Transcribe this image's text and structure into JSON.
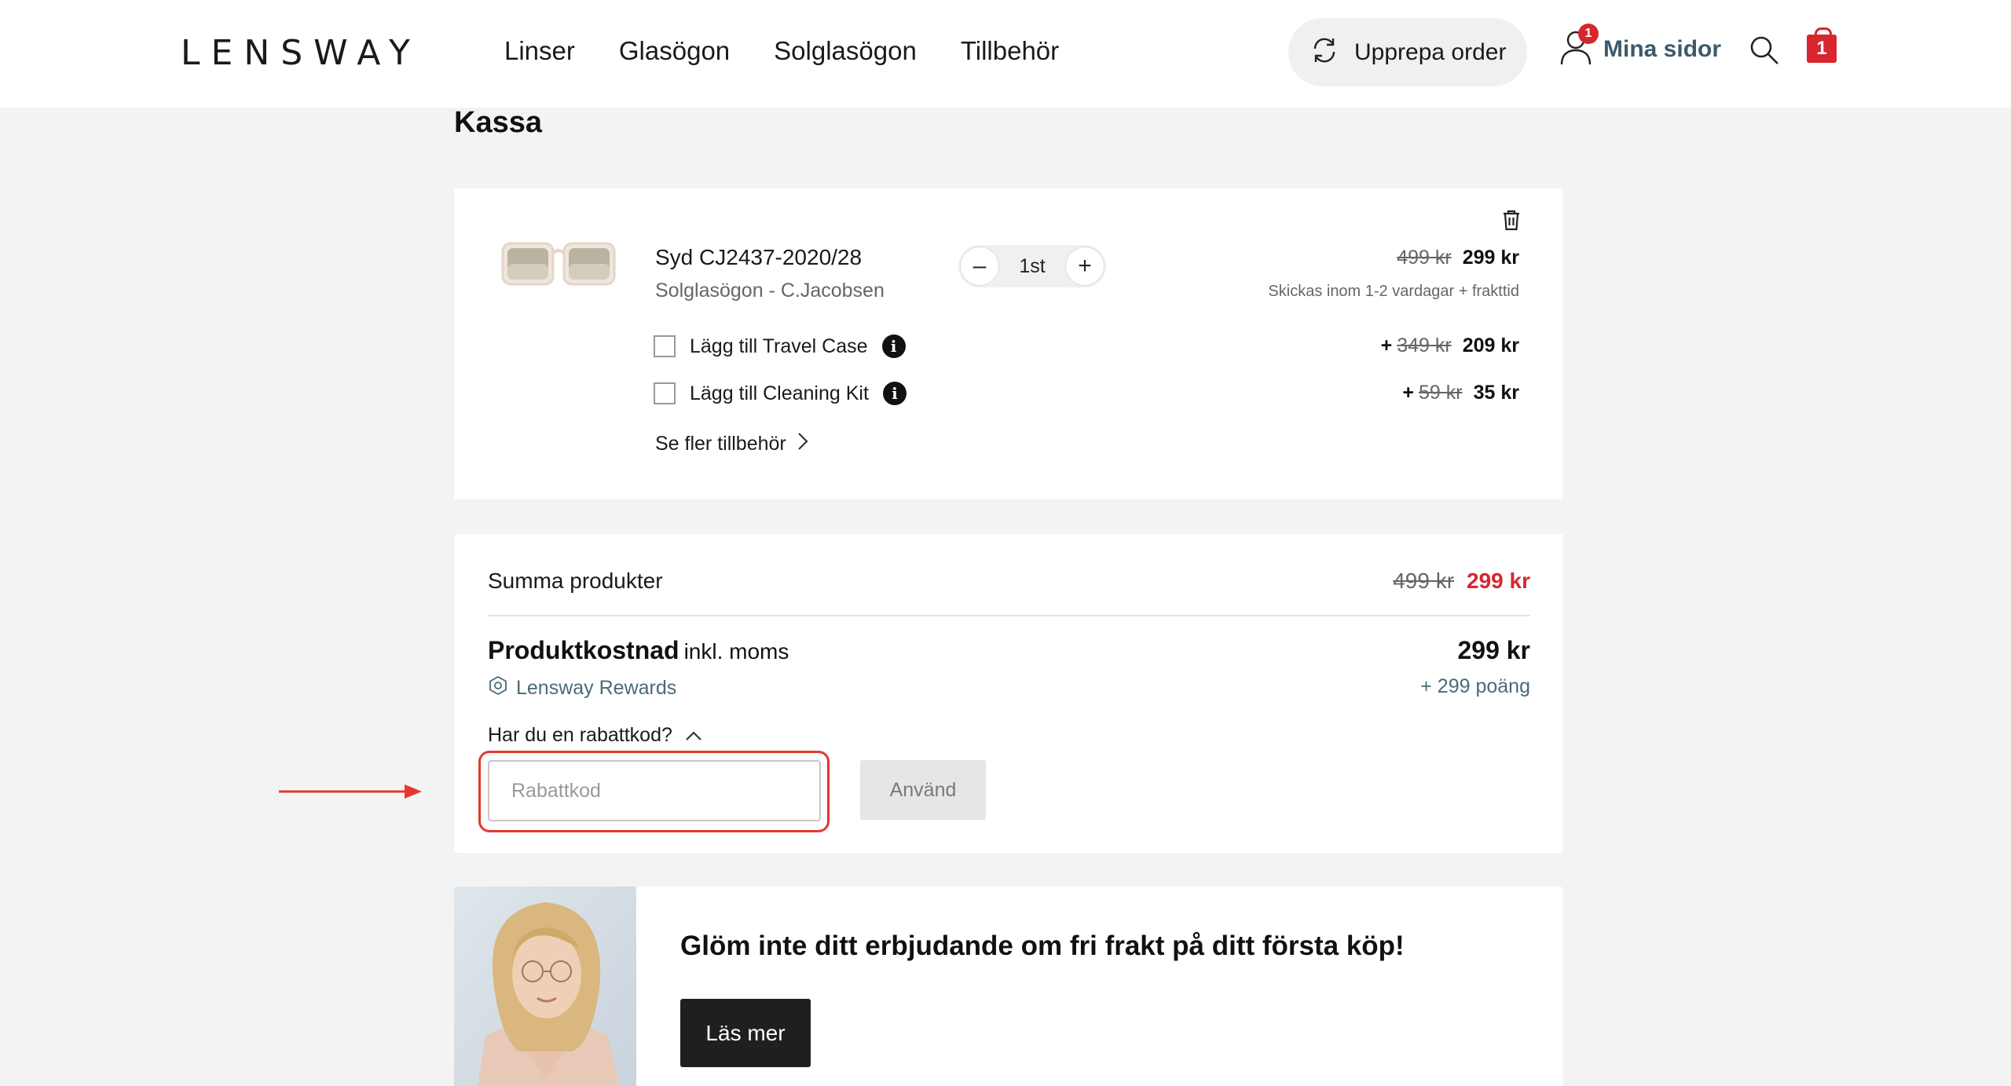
{
  "header": {
    "logo": "LENSWAY",
    "nav": [
      "Linser",
      "Glasögon",
      "Solglasögon",
      "Tillbehör"
    ],
    "repeat_order": "Upprepa order",
    "account_label": "Mina sidor",
    "account_badge": "1",
    "cart_count": "1"
  },
  "page": {
    "title": "Kassa"
  },
  "cart_item": {
    "name": "Syd CJ2437-2020/28",
    "subtitle": "Solglasögon - C.Jacobsen",
    "quantity": "1st",
    "old_price": "499 kr",
    "price": "299 kr",
    "shipping": "Skickas inom 1-2 vardagar + frakttid",
    "addons": [
      {
        "label": "Lägg till Travel Case",
        "plus": "+",
        "old_price": "349 kr",
        "price": "209 kr"
      },
      {
        "label": "Lägg till Cleaning Kit",
        "plus": "+",
        "old_price": "59 kr",
        "price": "35 kr"
      }
    ],
    "more_accessories": "Se fler tillbehör"
  },
  "summary": {
    "products_label": "Summa produkter",
    "products_old": "499 kr",
    "products_price": "299 kr",
    "cost_label": "Produktkostnad",
    "cost_suffix": "inkl. moms",
    "cost_price": "299 kr",
    "rewards_label": "Lensway Rewards",
    "points": "+ 299 poäng",
    "discount_question": "Har du en rabattkod?",
    "discount_placeholder": "Rabattkod",
    "apply_label": "Använd"
  },
  "promo": {
    "title": "Glöm inte ditt erbjudande om fri frakt på ditt första köp!",
    "button": "Läs mer"
  },
  "colors": {
    "accent_red": "#d8262e",
    "highlight_ring": "#e3392c",
    "rewards_blue": "#4a6a78"
  }
}
